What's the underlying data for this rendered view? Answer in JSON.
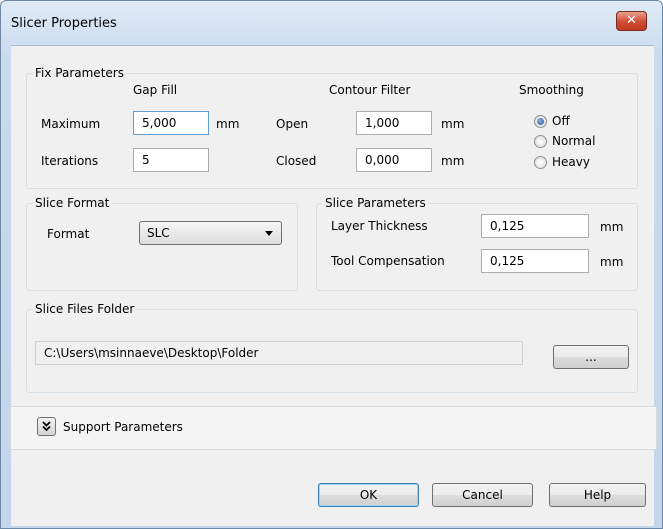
{
  "window": {
    "title": "Slicer Properties",
    "close_symbol": "✕"
  },
  "fix_parameters": {
    "title": "Fix Parameters",
    "gap_fill": {
      "header": "Gap Fill",
      "maximum_label": "Maximum",
      "maximum_value": "5,000",
      "maximum_unit": "mm",
      "iterations_label": "Iterations",
      "iterations_value": "5"
    },
    "contour_filter": {
      "header": "Contour Filter",
      "open_label": "Open",
      "open_value": "1,000",
      "open_unit": "mm",
      "closed_label": "Closed",
      "closed_value": "0,000",
      "closed_unit": "mm"
    },
    "smoothing": {
      "header": "Smoothing",
      "options": [
        "Off",
        "Normal",
        "Heavy"
      ],
      "selected": "Off"
    }
  },
  "slice_format": {
    "title": "Slice Format",
    "format_label": "Format",
    "format_value": "SLC"
  },
  "slice_parameters": {
    "title": "Slice Parameters",
    "layer_thickness_label": "Layer Thickness",
    "layer_thickness_value": "0,125",
    "layer_thickness_unit": "mm",
    "tool_compensation_label": "Tool Compensation",
    "tool_compensation_value": "0,125",
    "tool_compensation_unit": "mm"
  },
  "slice_files_folder": {
    "title": "Slice Files Folder",
    "path": "C:\\Users\\msinnaeve\\Desktop\\Folder",
    "browse_label": "..."
  },
  "support_parameters": {
    "label": "Support Parameters",
    "expand_icon": "double-chevron-down-icon"
  },
  "buttons": {
    "ok": "OK",
    "cancel": "Cancel",
    "help": "Help"
  }
}
